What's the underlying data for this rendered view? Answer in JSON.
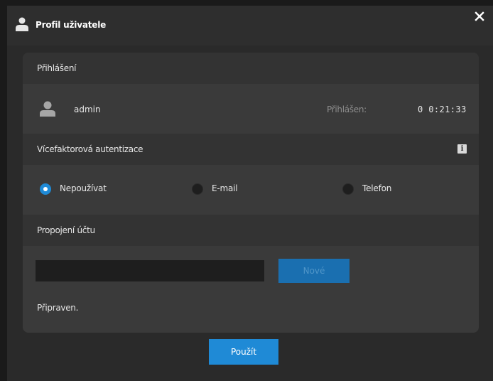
{
  "dialog": {
    "title": "Profil uživatele",
    "apply_label": "Použít"
  },
  "login": {
    "section_label": "Přihlášení",
    "username": "admin",
    "logged_in_label": "Přihlášen:",
    "logged_in_time": "0 0:21:33"
  },
  "mfa": {
    "section_label": "Vícefaktorová autentizace",
    "options": [
      {
        "label": "Nepoužívat",
        "checked": true
      },
      {
        "label": "E-mail",
        "checked": false
      },
      {
        "label": "Telefon",
        "checked": false
      }
    ]
  },
  "account_link": {
    "section_label": "Propojení účtu",
    "input_value": "",
    "new_label": "Nové",
    "status": "Připraven."
  },
  "icons": {
    "title": "user-icon",
    "close": "close-icon",
    "user": "user-icon",
    "info": "info-icon"
  },
  "colors": {
    "accent": "#1f8ad6",
    "disabled_accent": "#1a6fb0",
    "background": "#2a2a2a",
    "panel": "#3a3a3a"
  }
}
